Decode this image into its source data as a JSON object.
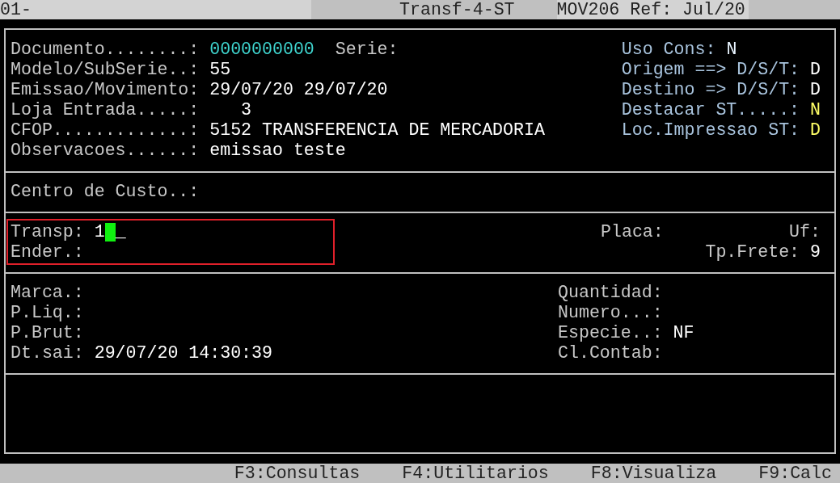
{
  "header": {
    "field": "01-",
    "program": "Transf-4-ST",
    "ref": "MOV206 Ref: Jul/20"
  },
  "document": {
    "left": [
      [
        {
          "label": "Documento........:",
          "value": "0000000000",
          "color": "#3fd6d0"
        },
        {
          "label": "Serie:"
        }
      ],
      [
        {
          "label": "Modelo/SubSerie..:",
          "value": "55",
          "color": "#ffffff"
        }
      ],
      [
        {
          "label": "Emissao/Movimento:",
          "value": "29/07/20 29/07/20",
          "color": "#ffffff"
        }
      ],
      [
        {
          "label": "Loja Entrada.....:",
          "value": "   3",
          "color": "#ffffff"
        }
      ],
      [
        {
          "label": "CFOP.............:",
          "value": "5152 TRANSFERENCIA DE MERCADORIA",
          "color": "#ffffff"
        }
      ],
      [
        {
          "label": "Observacoes......:",
          "value": "emissao teste",
          "color": "#ffffff"
        }
      ]
    ],
    "right": [
      {
        "label": "Uso Cons:",
        "value": "N",
        "color": "#e8f4ff"
      },
      {
        "label": "Origem ==> D/S/T:",
        "value": "D",
        "color": "#ffffff"
      },
      {
        "label": "Destino => D/S/T:",
        "value": "D",
        "color": "#ffffff"
      },
      {
        "label": "Destacar ST.....:",
        "value": "N",
        "color": "#ffff66"
      },
      {
        "label": "Loc.Impressao ST:",
        "value": "D",
        "color": "#ffff66"
      }
    ]
  },
  "cost_center": {
    "label": "Centro de Custo..:"
  },
  "carrier": {
    "left": [
      {
        "label": "Transp:",
        "value": "1",
        "cursor": true,
        "underscore": "_"
      },
      {
        "label": "Ender.:"
      }
    ],
    "plate_label": "Placa:",
    "uf_label": "Uf:",
    "freight": {
      "label": "Tp.Frete:",
      "value": "9"
    }
  },
  "volumes": {
    "left": [
      {
        "label": "Marca.:"
      },
      {
        "label": "P.Liq.:"
      },
      {
        "label": "P.Brut:"
      },
      {
        "label": "Dt.sai:",
        "value": "29/07/20 14:30:39"
      }
    ],
    "right": [
      {
        "label": "Quantidad:"
      },
      {
        "label": "Numero...:"
      },
      {
        "label": "Especie..:",
        "value": "NF"
      },
      {
        "label": "Cl.Contab:"
      }
    ]
  },
  "function_keys": [
    "F3:Consultas",
    "F4:Utilitarios",
    "F8:Visualiza",
    "F9:Calc"
  ]
}
